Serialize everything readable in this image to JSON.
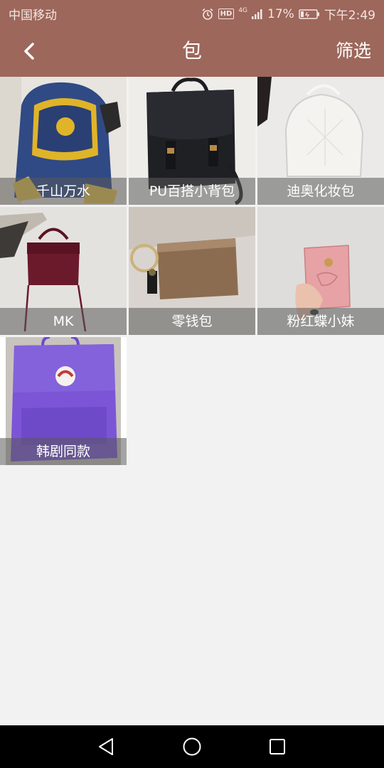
{
  "status_bar": {
    "carrier": "中国移动",
    "network": "4G",
    "hd": "HD",
    "battery": "17%",
    "time": "下午2:49"
  },
  "header": {
    "title": "包",
    "filter_label": "筛选"
  },
  "items": [
    {
      "label": "千山万水"
    },
    {
      "label": "PU百搭小背包"
    },
    {
      "label": "迪奥化妆包"
    },
    {
      "label": "MK"
    },
    {
      "label": "零钱包"
    },
    {
      "label": "粉红蝶小妹"
    },
    {
      "label": "韩剧同款"
    }
  ],
  "colors": {
    "header_bg": "#9d675b",
    "page_bg": "#f2f2f2",
    "nav_bg": "#000000"
  }
}
